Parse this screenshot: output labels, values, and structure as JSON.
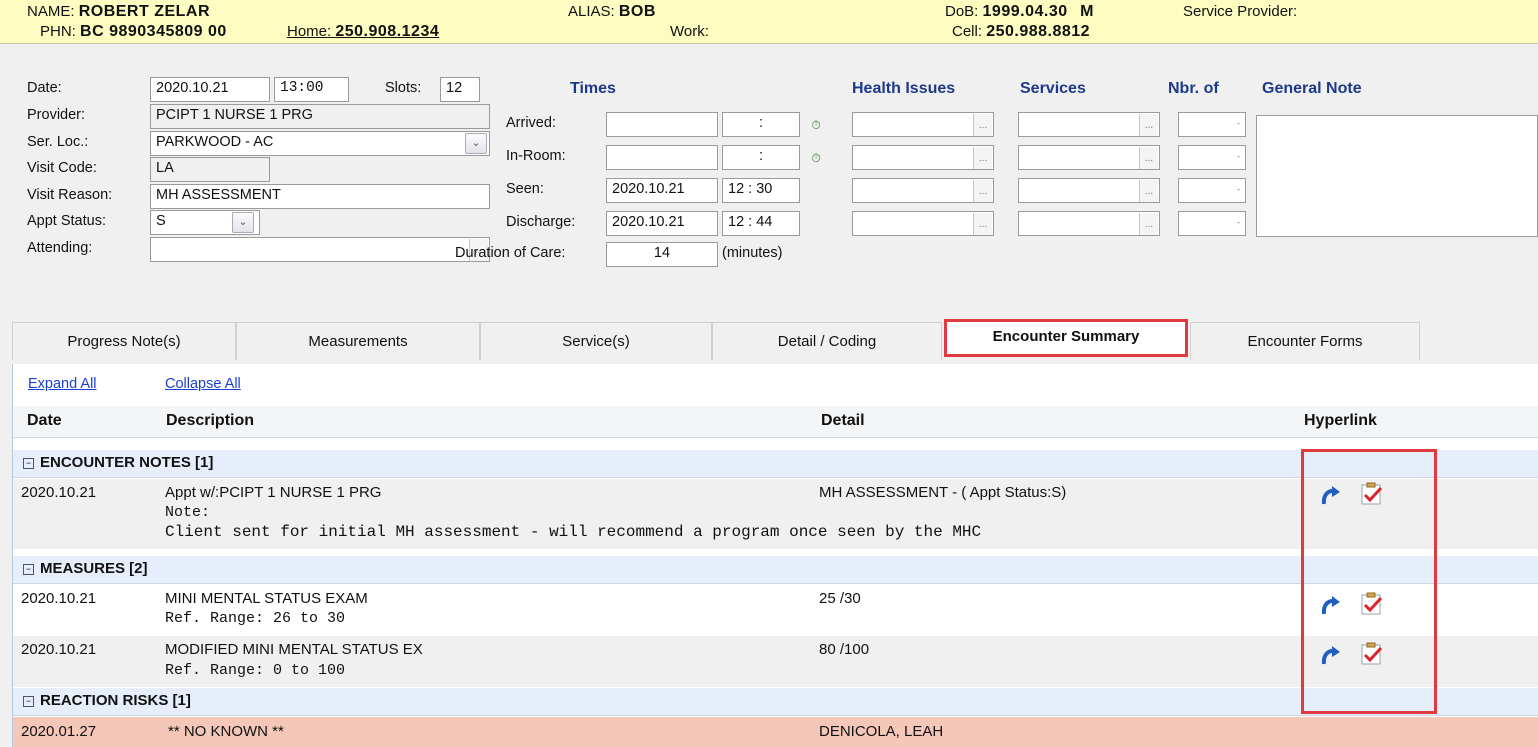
{
  "banner": {
    "name_label": "NAME:",
    "name_value": "ROBERT ZELAR",
    "alias_label": "ALIAS:",
    "alias_value": "BOB",
    "dob_label": "DoB:",
    "dob_value": "1999.04.30",
    "sex_value": "M",
    "service_provider_label": "Service Provider:",
    "phn_label": "PHN:",
    "phn_value": "BC 9890345809 00",
    "home_label": "Home:",
    "home_value": "250.908.1234",
    "work_label": "Work:",
    "cell_label": "Cell:",
    "cell_value": "250.988.8812"
  },
  "form": {
    "date_label": "Date:",
    "date_value": "2020.10.21",
    "time_value": "13:00",
    "slots_label": "Slots:",
    "slots_value": "12",
    "provider_label": "Provider:",
    "provider_value": "PCIPT 1 NURSE 1 PRG",
    "ser_loc_label": "Ser. Loc.:",
    "ser_loc_value": "PARKWOOD - AC",
    "visit_code_label": "Visit Code:",
    "visit_code_value": "LA",
    "visit_reason_label": "Visit Reason:",
    "visit_reason_value": "MH ASSESSMENT",
    "appt_status_label": "Appt Status:",
    "appt_status_value": "S",
    "attending_label": "Attending:",
    "attending_value": "",
    "ellipsis": "...",
    "times_header": "Times",
    "arrived_label": "Arrived:",
    "arrived_time": ":",
    "in_room_label": "In-Room:",
    "in_room_time": ":",
    "seen_label": "Seen:",
    "seen_date": "2020.10.21",
    "seen_time": "12 : 30",
    "discharge_label": "Discharge:",
    "discharge_date": "2020.10.21",
    "discharge_time": "12 : 44",
    "duration_label": "Duration of Care:",
    "duration_value": "14",
    "duration_unit": "(minutes)",
    "health_issues_header": "Health Issues",
    "services_header": "Services",
    "nbr_of_header": "Nbr. of",
    "general_note_header": "General Note",
    "spin_glyph": "-"
  },
  "tabs": [
    {
      "label": "Progress Note(s)"
    },
    {
      "label": "Measurements"
    },
    {
      "label": "Service(s)"
    },
    {
      "label": "Detail / Coding"
    },
    {
      "label": "Encounter Summary"
    },
    {
      "label": "Encounter Forms"
    }
  ],
  "summary": {
    "expand_all": "Expand All",
    "collapse_all": "Collapse All",
    "columns": {
      "date": "Date",
      "description": "Description",
      "detail": "Detail",
      "hyperlink": "Hyperlink"
    },
    "groups": {
      "encounter_notes": "ENCOUNTER NOTES   [1]",
      "measures": "MEASURES   [2]",
      "reaction_risks": "REACTION RISKS   [1]"
    },
    "rows": [
      {
        "date": "2020.10.21",
        "description": "Appt w/:PCIPT 1 NURSE 1 PRG",
        "detail": "MH ASSESSMENT - ( Appt Status:S)",
        "note_label": "Note:",
        "note": "Client sent for initial MH assessment - will recommend a program once seen by the MHC"
      },
      {
        "date": "2020.10.21",
        "description": "MINI MENTAL STATUS EXAM",
        "detail": "25 /30",
        "note": "Ref. Range: 26 to 30"
      },
      {
        "date": "2020.10.21",
        "description": "MODIFIED MINI MENTAL STATUS EX",
        "detail": "80 /100",
        "note": "Ref. Range: 0 to 100"
      },
      {
        "date": "2020.01.27",
        "description": "** NO KNOWN **",
        "detail": "DENICOLA, LEAH"
      }
    ]
  },
  "colors": {
    "accent_red": "#e0393e",
    "header_blue": "#1d3a8a",
    "link_blue": "#1a3fd6",
    "banner_yellow": "#fdfdc1",
    "reaction_row": "#f4c7b8"
  }
}
